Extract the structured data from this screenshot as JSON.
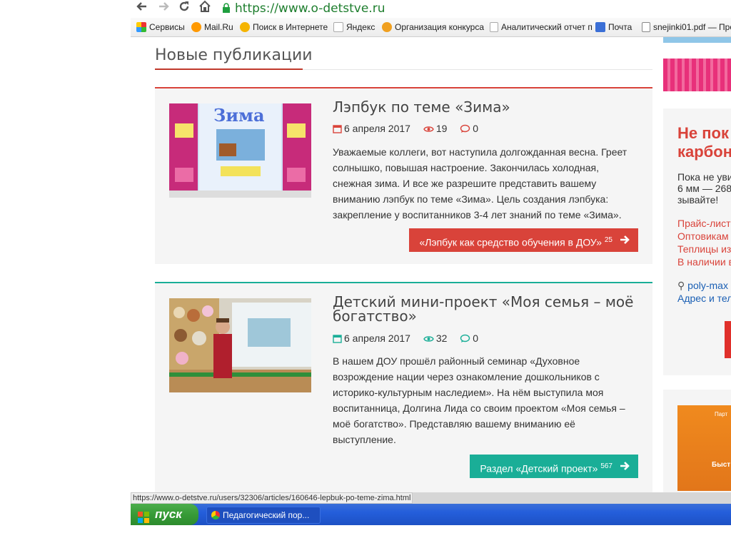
{
  "browser": {
    "url": "https://www.o-detstve.ru",
    "bookmarks": [
      "Сервисы",
      "Mail.Ru",
      "Поиск в Интернете",
      "Яндекс",
      "Организация конкурса",
      "Аналитический отчет п",
      "Почта",
      "snejinki01.pdf — Прос"
    ]
  },
  "section": {
    "title": "Новые публикации"
  },
  "articles": [
    {
      "title": "Лэпбук по теме «Зима»",
      "date": "6 апреля 2017",
      "views": "19",
      "comments": "0",
      "excerpt": "Уважаемые коллеги, вот наступила долгожданная весна. Греет солнышко, повышая настроение. Закончилась холодная, снежная зима. И все же разрешите представить вашему вниманию лэпбук по теме «Зима». Цель создания лэпбука: закрепление у воспитанников 3-4 лет знаний по теме «Зима».",
      "button_label": "«Лэпбук как средство обучения в ДОУ»",
      "button_count": "25",
      "thumb_text": "Зима",
      "accent": "#d9433a"
    },
    {
      "title": "Детский мини-проект «Моя семья – моё богатство»",
      "date": "6 апреля 2017",
      "views": "32",
      "comments": "0",
      "excerpt": "В нашем ДОУ прошёл районный семинар «Духовное возрождение нации через ознакомление дошкольников с историко-культурным наследием». На нём выступила моя воспитанница, Долгина Лида со своим проектом «Моя семья – моё богатство». Представляю вашему вниманию её выступление.",
      "button_label": "Раздел «Детский проект»",
      "button_count": "567",
      "accent": "#1aae97"
    }
  ],
  "sidebar": {
    "ad_title_1": "Не пок",
    "ad_title_2": "карбон",
    "ad_text_1": "Пока не уви",
    "ad_text_2": "6 мм — 268",
    "ad_text_3": "зывайте!",
    "links": [
      "Прайс-лист",
      "Оптовикам",
      "Теплицы из",
      "В наличии в"
    ],
    "site_link": "poly-max",
    "contact_link": "Адрес и тел",
    "promo_small": "Парт",
    "promo_big": "Быст"
  },
  "statusbar": {
    "url": "https://www.o-detstve.ru/users/32306/articles/160646-lepbuk-po-teme-zima.html"
  },
  "taskbar": {
    "start_label": "пуск",
    "task_label": "Педагогический пор..."
  },
  "colors": {
    "red_accent": "#d9433a",
    "teal_accent": "#1aae97",
    "section_underline": "#c0392b",
    "url_green": "#1e7e2e"
  }
}
